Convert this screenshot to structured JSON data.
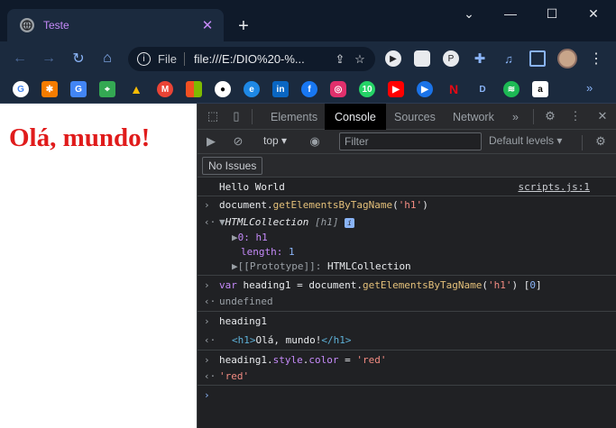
{
  "browser": {
    "tab": {
      "title": "Teste"
    },
    "window_controls": {
      "collapse": "⌄",
      "minimize": "—",
      "maximize": "☐",
      "close": "✕"
    },
    "omnibox": {
      "scheme_label": "File",
      "url": "file:///E:/DIO%20-%..."
    },
    "bookmarks": [
      "google",
      "tango",
      "translate",
      "maps",
      "drive",
      "gmail",
      "microsoft",
      "github",
      "edge",
      "linkedin",
      "facebook",
      "instagram",
      "whatsapp",
      "youtube",
      "video",
      "netflix",
      "disney",
      "spotify",
      "amazon"
    ],
    "bookmarks_more": "»"
  },
  "page": {
    "heading": "Olá, mundo!"
  },
  "devtools": {
    "tabs": [
      "Elements",
      "Console",
      "Sources",
      "Network"
    ],
    "active_tab": "Console",
    "more_tabs": "»",
    "context": "top ▾",
    "filter_placeholder": "Filter",
    "levels": "Default levels ▾",
    "issues_label": "No Issues",
    "console": {
      "log_message": "Hello World",
      "log_source": "scripts.js:1",
      "cmd1_obj": "document.",
      "cmd1_fn": "getElementsByTagName",
      "cmd1_open": "(",
      "cmd1_arg": "'h1'",
      "cmd1_close": ")",
      "res1_type": "HTMLCollection",
      "res1_bracket": "[h1]",
      "res1_item_key": "0: ",
      "res1_item_val": "h1",
      "res1_length_key": "length: ",
      "res1_length_val": "1",
      "res1_proto_key": "[[Prototype]]: ",
      "res1_proto_val": "HTMLCollection",
      "cmd2_kw": "var",
      "cmd2_rest": " heading1 = document.",
      "cmd2_fn": "getElementsByTagName",
      "cmd2_open": "(",
      "cmd2_arg": "'h1'",
      "cmd2_close": ") [",
      "cmd2_idx": "0",
      "cmd2_end": "]",
      "res2": "undefined",
      "cmd3": "heading1",
      "res3_open": "<h1>",
      "res3_text": "Olá, mundo!",
      "res3_close": "</h1>",
      "cmd4_obj": "heading1.",
      "cmd4_prop": "style",
      "cmd4_dot": ".",
      "cmd4_prop2": "color",
      "cmd4_eq": " = ",
      "cmd4_val": "'red'",
      "res4": "'red'"
    }
  },
  "colors": {
    "heading": "#e01b1b",
    "tab_title": "#c58af9",
    "accent": "#8ab4f8"
  }
}
